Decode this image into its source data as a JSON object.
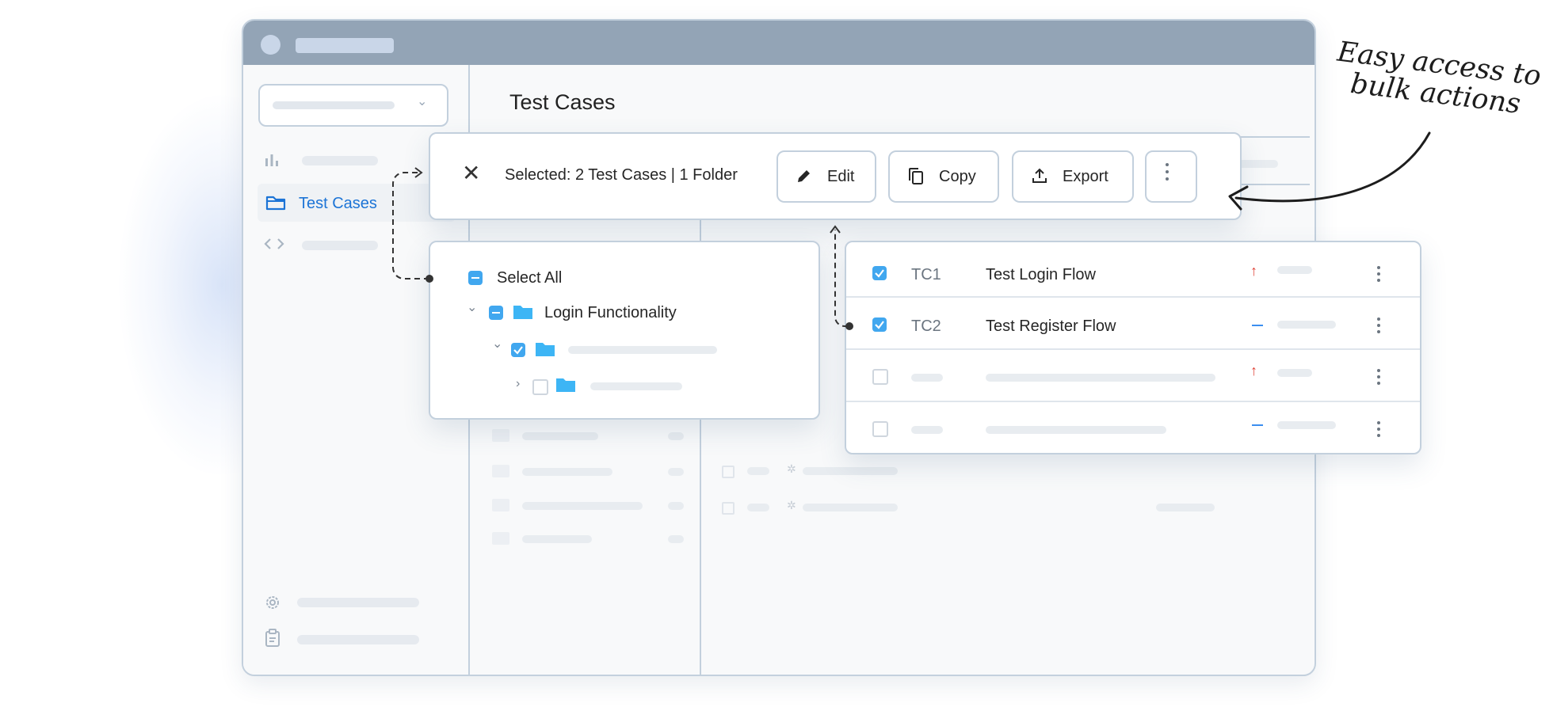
{
  "annotation": {
    "text_line1": "Easy access to",
    "text_line2": "bulk actions"
  },
  "sidebar": {
    "active_item_label": "Test Cases",
    "icons": [
      "bar-chart-icon",
      "folder-icon",
      "code-icon",
      "gear-icon",
      "clipboard-icon"
    ]
  },
  "main": {
    "title": "Test Cases"
  },
  "toolbar": {
    "selection_text": "Selected: 2 Test Cases | 1 Folder",
    "edit_label": "Edit",
    "copy_label": "Copy",
    "export_label": "Export"
  },
  "tree": {
    "select_all_label": "Select All",
    "folder_label": "Login Functionality"
  },
  "test_cases": [
    {
      "id": "TC1",
      "name": "Test Login Flow",
      "checked": true,
      "priority": "high"
    },
    {
      "id": "TC2",
      "name": "Test Register Flow",
      "checked": true,
      "priority": "medium"
    },
    {
      "id": "",
      "name": "",
      "checked": false,
      "priority": "high"
    },
    {
      "id": "",
      "name": "",
      "checked": false,
      "priority": "medium"
    }
  ],
  "colors": {
    "accent": "#1c74d6",
    "checkbox": "#41a7ef",
    "folder": "#3db5f5",
    "titlebar": "#93a4b6",
    "priority_high": "#e0453a",
    "priority_medium": "#3b8ef0"
  }
}
